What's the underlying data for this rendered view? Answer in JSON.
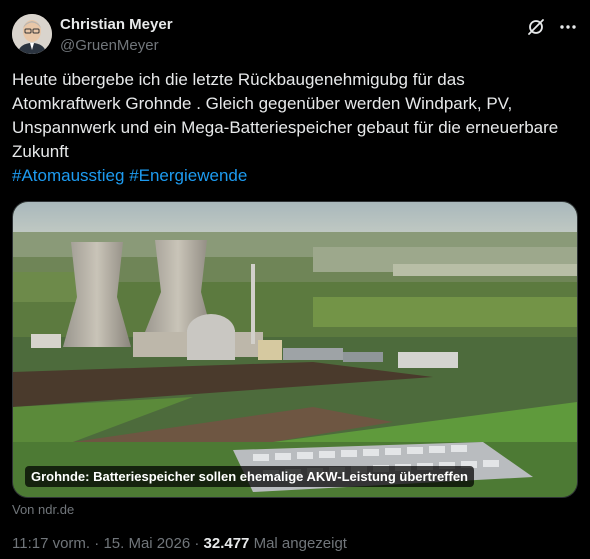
{
  "author": {
    "name": "Christian Meyer",
    "handle": "@GruenMeyer"
  },
  "tweet": {
    "text": "Heute übergebe ich die letzte Rückbaugenehmigubg für das Atomkraftwerk Grohnde . Gleich gegenüber werden Windpark, PV, Unspannwerk und ein Mega-Batteriespeicher gebaut für die erneuerbare Zukunft",
    "hashtags": [
      "#Atomausstieg",
      "#Energiewende"
    ]
  },
  "media": {
    "caption": "Grohnde: Batteriespeicher sollen ehemalige AKW-Leistung übertreffen",
    "source": "Von ndr.de"
  },
  "meta": {
    "time": "11:17 vorm.",
    "separator": "·",
    "date": "15. Mai 2026",
    "views_count": "32.477",
    "views_label": "Mal angezeigt"
  },
  "icons": {
    "grok": "grok-icon",
    "more": "more-icon"
  },
  "colors": {
    "background": "#000000",
    "text": "#e7e9ea",
    "secondary": "#71767b",
    "link": "#1d9bf0"
  }
}
